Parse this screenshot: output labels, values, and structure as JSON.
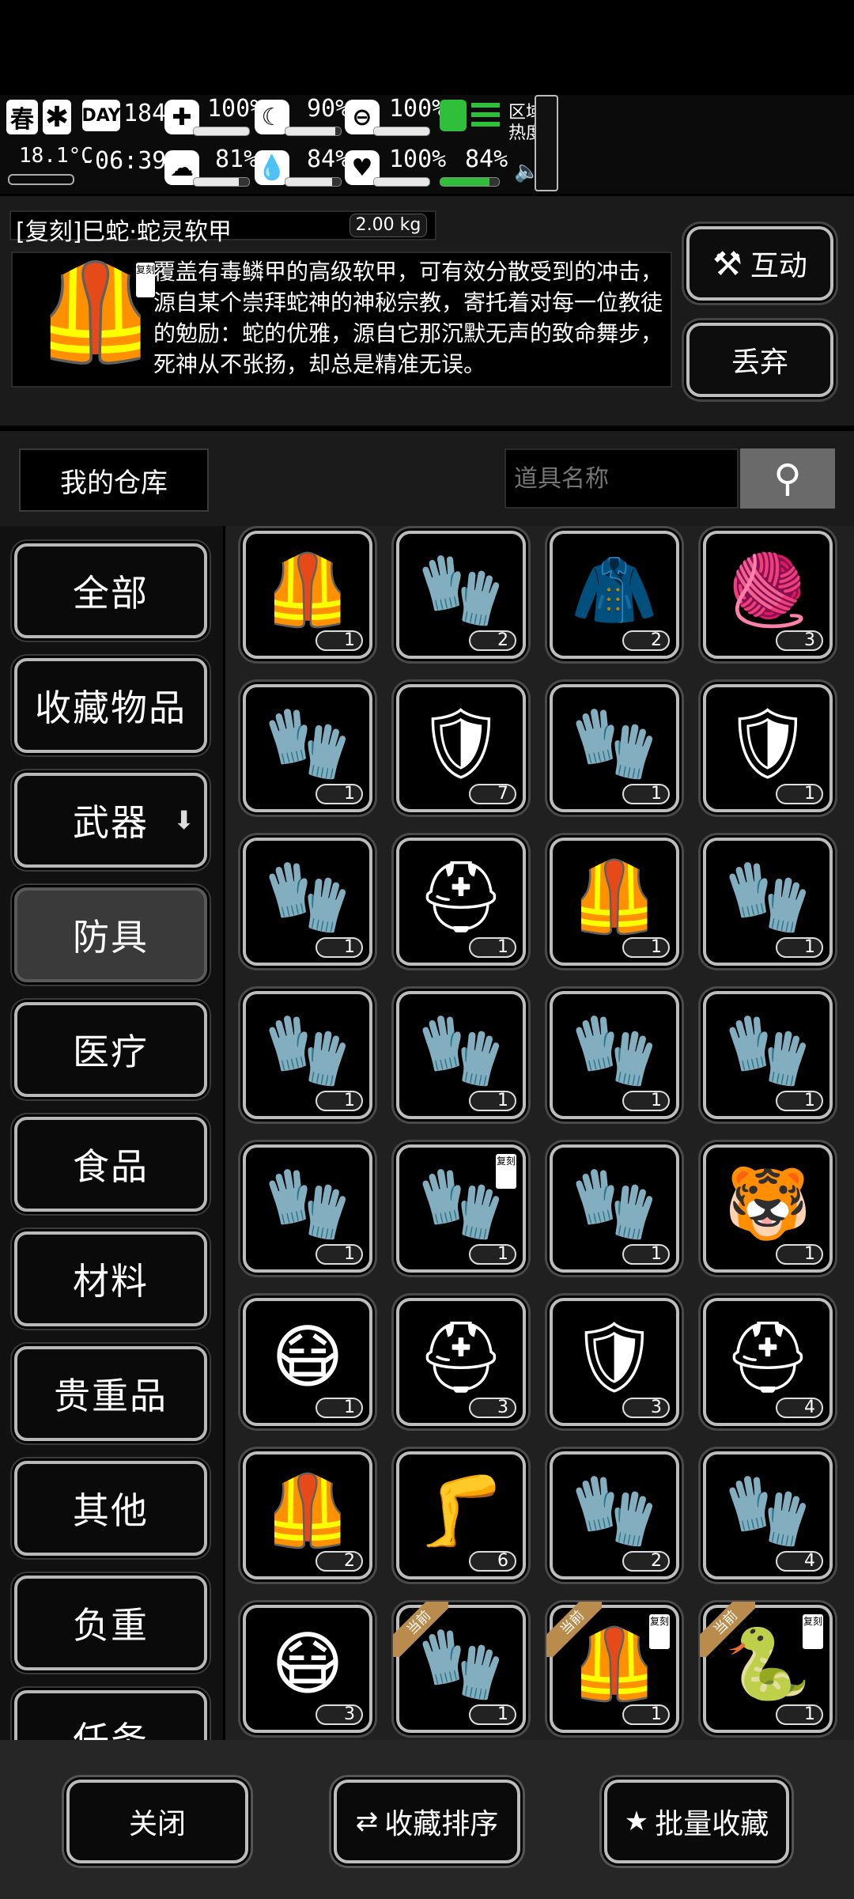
{
  "hud": {
    "season": "春",
    "temperature": "18.1°C",
    "day_label": "DAY",
    "day_number": "184",
    "clock": "-06:39-",
    "stats": [
      {
        "name": "health",
        "value": "100%",
        "level": 1.0
      },
      {
        "name": "hunger",
        "value": "90%",
        "level": 0.9
      },
      {
        "name": "armor",
        "value": "100%",
        "level": 1.0
      },
      {
        "name": "mood",
        "value": "81%",
        "level": 0.81
      },
      {
        "name": "thirst",
        "value": "84%",
        "level": 0.84
      },
      {
        "name": "heart",
        "value": "100%",
        "level": 1.0
      }
    ],
    "stamina": {
      "value": "84%",
      "level": 0.84
    },
    "zone_heat_label_1": "区域",
    "zone_heat_label_2": "热度"
  },
  "detail": {
    "item_name": "[复刻]巳蛇·蛇灵软甲",
    "weight": "2.00 kg",
    "badge": "复刻",
    "description": "覆盖有毒鳞甲的高级软甲，可有效分散受到的冲击，源自某个崇拜蛇神的神秘宗教，寄托着对每一位教徒的勉励：蛇的优雅，源自它那沉默无声的致命舞步，死神从不张扬，却总是精准无误。",
    "interact_label": "互动",
    "discard_label": "丢弃"
  },
  "storage": {
    "title": "我的仓库",
    "search_placeholder": "道具名称"
  },
  "nav": [
    {
      "label": "全部",
      "active": false
    },
    {
      "label": "收藏物品",
      "active": false
    },
    {
      "label": "武器",
      "active": false,
      "arrow": true
    },
    {
      "label": "防具",
      "active": true
    },
    {
      "label": "医疗",
      "active": false
    },
    {
      "label": "食品",
      "active": false
    },
    {
      "label": "材料",
      "active": false
    },
    {
      "label": "贵重品",
      "active": false
    },
    {
      "label": "其他",
      "active": false
    },
    {
      "label": "负重",
      "active": false
    },
    {
      "label": "任务",
      "active": false
    }
  ],
  "items": [
    {
      "icon": "fur-vest-icon",
      "glyph": "🦺",
      "count": "1"
    },
    {
      "icon": "tactical-gloves-icon",
      "glyph": "🧤",
      "count": "2"
    },
    {
      "icon": "jacket-icon",
      "glyph": "🧥",
      "count": "2"
    },
    {
      "icon": "beanie-icon",
      "glyph": "🧶",
      "count": "3"
    },
    {
      "icon": "fur-wraps-icon",
      "glyph": "🧤",
      "count": "1"
    },
    {
      "icon": "plate-armor-icon",
      "glyph": "🛡",
      "count": "7"
    },
    {
      "icon": "red-gauntlets-icon",
      "glyph": "🧤",
      "count": "1",
      "red": true
    },
    {
      "icon": "body-armor-icon",
      "glyph": "🛡",
      "count": "1"
    },
    {
      "icon": "fingerless-gloves-icon",
      "glyph": "🧤",
      "count": "1"
    },
    {
      "icon": "combat-helmet-icon",
      "glyph": "⛑",
      "count": "1"
    },
    {
      "icon": "tactical-vest-icon",
      "glyph": "🦺",
      "count": "1"
    },
    {
      "icon": "arm-guards-icon",
      "glyph": "🧤",
      "count": "1"
    },
    {
      "icon": "tactical-gloves-icon",
      "glyph": "🧤",
      "count": "1"
    },
    {
      "icon": "arm-guards-icon",
      "glyph": "🧤",
      "count": "1"
    },
    {
      "icon": "fingerless-gloves-icon",
      "glyph": "🧤",
      "count": "1"
    },
    {
      "icon": "gauntlet-icon",
      "glyph": "🧤",
      "count": "1"
    },
    {
      "icon": "arm-guards-icon",
      "glyph": "🧤",
      "count": "1"
    },
    {
      "icon": "snake-gloves-icon",
      "glyph": "🧤",
      "count": "1",
      "tag": "复刻"
    },
    {
      "icon": "glove-icon",
      "glyph": "🧤",
      "count": "1"
    },
    {
      "icon": "tiger-hat-icon",
      "glyph": "🐯",
      "count": "1"
    },
    {
      "icon": "gas-mask-icon",
      "glyph": "😷",
      "count": "1"
    },
    {
      "icon": "helmet-icon",
      "glyph": "⛑",
      "count": "3"
    },
    {
      "icon": "armor-vest-icon",
      "glyph": "🛡",
      "count": "3"
    },
    {
      "icon": "visor-helmet-icon",
      "glyph": "⛑",
      "count": "4"
    },
    {
      "icon": "vest-icon",
      "glyph": "🦺",
      "count": "2"
    },
    {
      "icon": "shin-guards-icon",
      "glyph": "🦵",
      "count": "6"
    },
    {
      "icon": "work-gloves-icon",
      "glyph": "🧤",
      "count": "2"
    },
    {
      "icon": "padded-gloves-icon",
      "glyph": "🧤",
      "count": "4"
    },
    {
      "icon": "gas-mask-icon",
      "glyph": "😷",
      "count": "3"
    },
    {
      "icon": "beast-gloves-icon",
      "glyph": "🧤",
      "count": "1",
      "season": "当前"
    },
    {
      "icon": "snake-armor-icon",
      "glyph": "🦺",
      "count": "1",
      "season": "当前",
      "tag": "复刻"
    },
    {
      "icon": "snake-helmet-icon",
      "glyph": "🐍",
      "count": "1",
      "season": "当前",
      "tag": "复刻"
    }
  ],
  "bottom": {
    "close_label": "关闭",
    "sort_label": "收藏排序",
    "batch_label": "批量收藏"
  },
  "colors": {
    "accent_green": "#2fbf3a",
    "highlight_red": "#e52b1f",
    "season_ribbon": "#b98b4c"
  }
}
